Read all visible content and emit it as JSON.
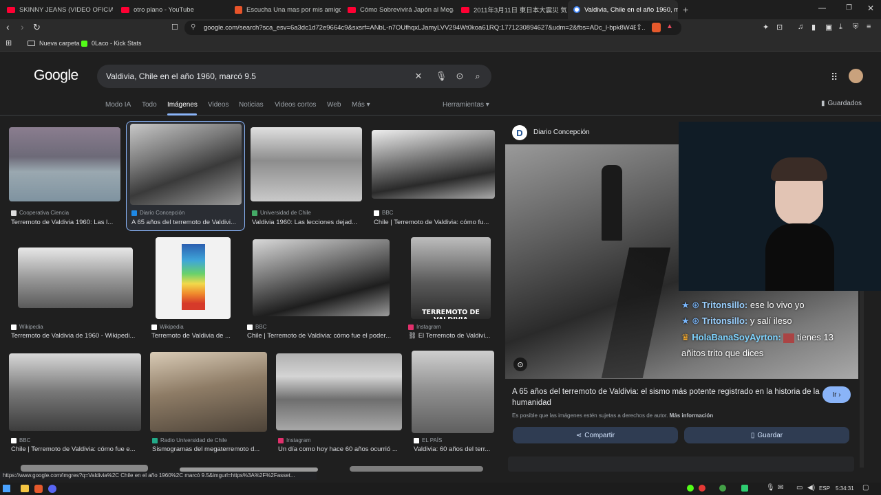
{
  "tabs": [
    {
      "label": "SKINNY JEANS (VIDEO OFICIAL) - Yo",
      "favicon_color": "#ff0033"
    },
    {
      "label": "otro plano - YouTube",
      "favicon_color": "#ff0033"
    },
    {
      "label": "Escucha Una mas por mis amigos. Pr",
      "favicon_color": "#e8542a"
    },
    {
      "label": "Cómo Sobrevivirá Japón al Megaterr",
      "favicon_color": "#ff0033"
    },
    {
      "label": "2011年3月11日 東日本大震災 気仙沼",
      "favicon_color": "#ff0033"
    },
    {
      "label": "Valdivia, Chile en el año 1960, m",
      "favicon_color": "#4285f4"
    }
  ],
  "address_bar": {
    "url": "google.com/search?sca_esv=6a3dc1d72e9664c9&sxsrf=ANbL-n7OUfhqxLJamyLVV294Wt0koa61RQ:1771230894627&udm=2&fbs=ADc_l-bpk8W4E-..."
  },
  "bookmarks": [
    {
      "label": "Nueva carpeta"
    },
    {
      "label": "0Laco - Kick Stats"
    }
  ],
  "google": {
    "logo": "Google",
    "query": "Valdivia, Chile en el año 1960, marcó 9.5",
    "nav_tabs": [
      "Modo IA",
      "Todo",
      "Imágenes",
      "Videos",
      "Noticias",
      "Videos cortos",
      "Web",
      "Más ▾"
    ],
    "tools": "Herramientas ▾",
    "saved": "Guardados"
  },
  "results": [
    {
      "source": "Cooperativa Ciencia",
      "title": "Terremoto de Valdivia 1960: Las l..."
    },
    {
      "source": "Diario Concepción",
      "title": "A 65 años del terremoto de Valdivi..."
    },
    {
      "source": "Universidad de Chile",
      "title": "Valdivia 1960: Las lecciones dejad..."
    },
    {
      "source": "BBC",
      "title": "Chile | Terremoto de Valdivia: cómo fu..."
    },
    {
      "source": "Wikipedia",
      "title": "Terremoto de Valdivia de 1960 - Wikipedi..."
    },
    {
      "source": "Wikipedia",
      "title": "Terremoto de Valdivia de ..."
    },
    {
      "source": "BBC",
      "title": "Chile | Terremoto de Valdivia: cómo fue el poder..."
    },
    {
      "source": "Instagram",
      "title": "⛓ El Terremoto de Valdivi..."
    },
    {
      "source": "BBC",
      "title": "Chile | Terremoto de Valdivia: cómo fue e..."
    },
    {
      "source": "Radio Universidad de Chile",
      "title": "Sismogramas del megaterremoto d..."
    },
    {
      "source": "Instagram",
      "title": "Un día como hoy hace 60 años ocurrió ..."
    },
    {
      "source": "EL PAÍS",
      "title": "Valdivia: 60 años del terr..."
    }
  ],
  "thumb_overlay": "TERREMOTO DE VALDIVIA",
  "panel": {
    "source": "Diario Concepción",
    "title": "A 65 años del terremoto de Valdivia: el sismo más potente registrado en la historia de la humanidad",
    "go_button": "Ir ›",
    "copyright": "Es posible que las imágenes estén sujetas a derechos de autor.",
    "more_info": "Más información",
    "share": "Compartir",
    "save": "Guardar"
  },
  "chat": [
    {
      "user": "Tritonsillo:",
      "text": "ese lo vivo yo"
    },
    {
      "user": "Tritonsillo:",
      "text": "y salí ileso"
    },
    {
      "user": "HolaBanaSoyAyrton:",
      "text": "tienes 13"
    },
    {
      "user": "",
      "text": "añitos trito que dices"
    }
  ],
  "status_url": "https://www.google.com/imgres?q=Valdivia%2C Chile en el año 1960%2C marcó 9.5&imgurl=https%3A%2F%2Fasset...",
  "taskbar": {
    "lang": "ESP",
    "time": "5:34:31"
  }
}
